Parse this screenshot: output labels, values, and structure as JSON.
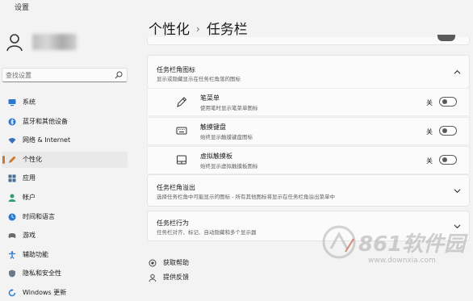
{
  "app": {
    "title": "设置"
  },
  "sidebar": {
    "search_placeholder": "查找设置",
    "items": [
      {
        "label": "系统",
        "icon": "monitor-icon",
        "color": "#2b79d4"
      },
      {
        "label": "蓝牙和其他设备",
        "icon": "bluetooth-icon",
        "color": "#2b79d4"
      },
      {
        "label": "网络 & Internet",
        "icon": "wifi-icon",
        "color": "#3b6fb8"
      },
      {
        "label": "个性化",
        "icon": "pen-icon",
        "color": "#c7792f",
        "active": true
      },
      {
        "label": "应用",
        "icon": "apps-icon",
        "color": "#4a6e91"
      },
      {
        "label": "帐户",
        "icon": "account-icon",
        "color": "#2f9e6a"
      },
      {
        "label": "时间和语言",
        "icon": "globe-clock-icon",
        "color": "#2b79d4"
      },
      {
        "label": "游戏",
        "icon": "gamepad-icon",
        "color": "#6a6a6a"
      },
      {
        "label": "辅助功能",
        "icon": "accessibility-icon",
        "color": "#2b79d4"
      },
      {
        "label": "隐私和安全性",
        "icon": "shield-icon",
        "color": "#6a7a8a"
      },
      {
        "label": "Windows 更新",
        "icon": "update-icon",
        "color": "#2b79d4"
      }
    ]
  },
  "header": {
    "crumb_parent": "个性化",
    "crumb_sep": "›",
    "crumb_current": "任务栏"
  },
  "corner_icons": {
    "title": "任务栏角图标",
    "subtitle": "显示或隐藏显示在任务栏角落的图标",
    "items": [
      {
        "title": "笔菜单",
        "subtitle": "使用笔时显示笔菜单图标",
        "state": "关",
        "icon": "pen-menu-icon"
      },
      {
        "title": "触摸键盘",
        "subtitle": "始终显示触摸键盘图标",
        "state": "关",
        "icon": "keyboard-icon"
      },
      {
        "title": "虚拟触摸板",
        "subtitle": "始终显示虚拟触摸板图标",
        "state": "关",
        "icon": "touchpad-icon"
      }
    ]
  },
  "overflow": {
    "title": "任务栏角溢出",
    "subtitle": "选择任务栏角中可能显示的图标 - 所有其他图标将显示在任务栏角溢出菜单中"
  },
  "behaviors": {
    "title": "任务栏行为",
    "subtitle": "任务栏对齐、标记、自动隐藏和多个显示器"
  },
  "footer": {
    "help": "获取帮助",
    "feedback": "提供反馈"
  },
  "watermark": {
    "brand": "861软件园",
    "url": "www.downxia.com"
  },
  "colors": {
    "accent": "#c7792f",
    "bg": "#f3f3f3",
    "card": "#fbfbfb"
  }
}
